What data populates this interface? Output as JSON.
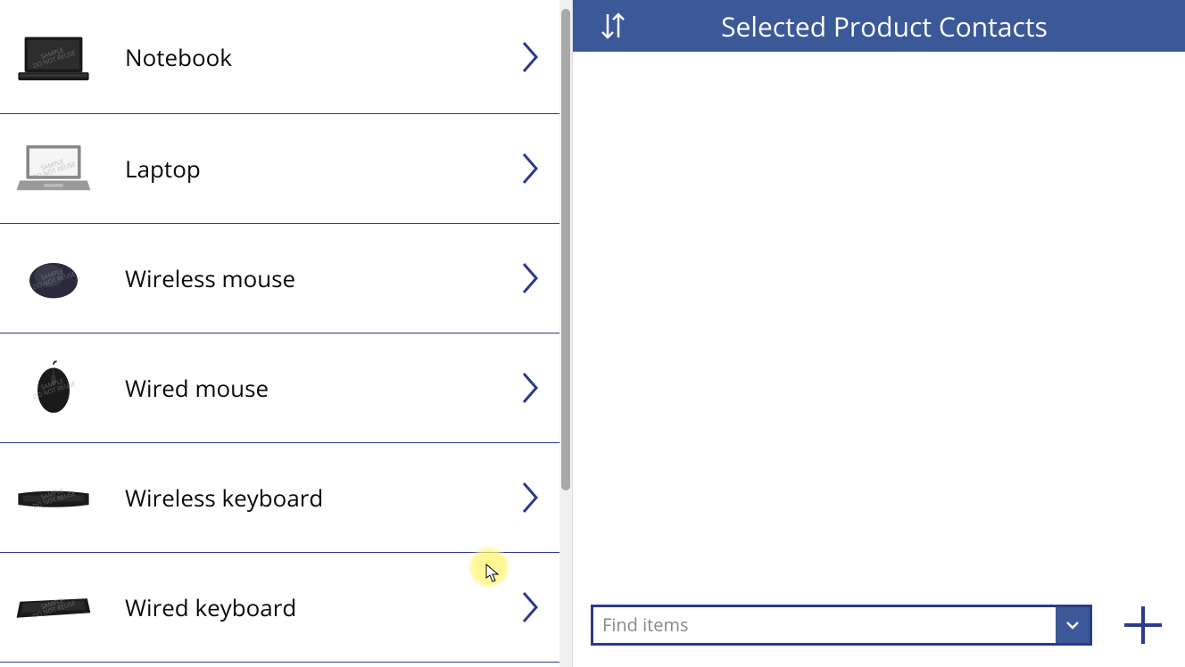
{
  "products": [
    {
      "label": "Notebook",
      "icon": "notebook"
    },
    {
      "label": "Laptop",
      "icon": "laptop"
    },
    {
      "label": "Wireless mouse",
      "icon": "wireless-mouse"
    },
    {
      "label": "Wired mouse",
      "icon": "wired-mouse"
    },
    {
      "label": "Wireless keyboard",
      "icon": "wireless-keyboard"
    },
    {
      "label": "Wired keyboard",
      "icon": "wired-keyboard"
    }
  ],
  "rightPanel": {
    "title": "Selected Product Contacts",
    "findPlaceholder": "Find items"
  },
  "colors": {
    "accent": "#3b5998",
    "darkAccent": "#2b3a8b"
  }
}
